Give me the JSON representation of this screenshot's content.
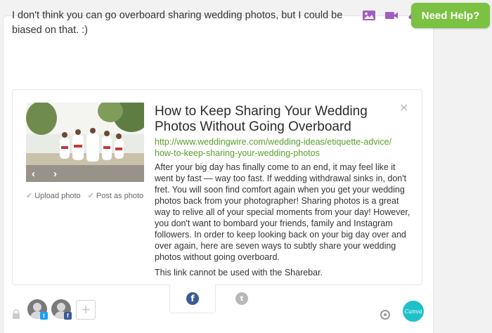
{
  "composer": {
    "text": "I don't think you can go overboard sharing wedding photos, but I could be biased on that.  :)",
    "media_icons": [
      "image-icon",
      "video-icon",
      "upload-icon"
    ]
  },
  "help": {
    "label": "Need Help?"
  },
  "link_preview": {
    "title": "How to Keep Sharing Your Wedding Photos Without Going Overboard",
    "url": "http://www.weddingwire.com/wedding-ideas/etiquette-advice/how-to-keep-sharing-your-wedding-photos",
    "description": "After your big day has finally come to an end, it may feel like it went by fast — way too fast. If wedding withdrawal sinks in, don't fret. You will soon find comfort again when you get your wedding photos back from your photographer! Sharing photos is a great way to relive all of your special moments from your day! However, you don't want to bombard your friends, family and Instagram followers. In order to keep looking back on your big day over and over again, here are seven ways to subtly share your wedding photos without going overboard.",
    "note": "This link cannot be used with the Sharebar.",
    "nav": {
      "prev": "‹",
      "next": "›"
    },
    "options": {
      "upload_photo": "Upload photo",
      "post_as_photo": "Post as photo"
    }
  },
  "share": {
    "networks": [
      "facebook",
      "twitter"
    ],
    "facebook_glyph": "f",
    "twitter_glyph": "t"
  },
  "accounts": {
    "badges": {
      "twitter": "t",
      "facebook": "f"
    },
    "add_label": "+"
  },
  "canva": {
    "label": "Canva"
  },
  "colors": {
    "accent_purple": "#a05ec2",
    "help_green": "#7cc242",
    "url_green": "#5aa02c",
    "facebook": "#3b5b98",
    "canva": "#1fc1c8"
  }
}
